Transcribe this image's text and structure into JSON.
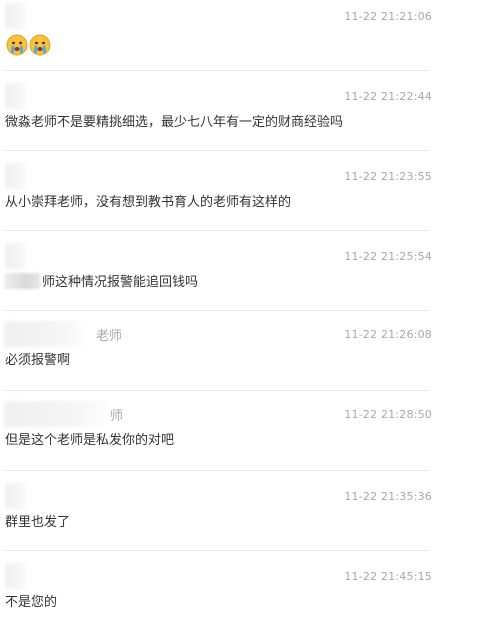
{
  "comments": [
    {
      "time": "11-22 21:21:06",
      "content": "",
      "emoji": "crying-face-icon"
    },
    {
      "time": "11-22 21:22:44",
      "content": "微淼老师不是要精挑细选，最少七八年有一定的财商经验吗"
    },
    {
      "time": "11-22 21:23:55",
      "content": "从小崇拜老师，没有想到教书育人的老师有这样的"
    },
    {
      "time": "11-22 21:25:54",
      "content": "师这种情况报警能追回钱吗"
    },
    {
      "time": "11-22 21:26:08",
      "name_tail": "老师",
      "content": "必须报警啊"
    },
    {
      "time": "11-22 21:28:50",
      "name_tail": "师",
      "content": "但是这个老师是私发你的对吧"
    },
    {
      "time": "11-22 21:35:36",
      "content": "群里也发了"
    },
    {
      "time": "11-22 21:45:15",
      "content": "不是您的"
    }
  ]
}
